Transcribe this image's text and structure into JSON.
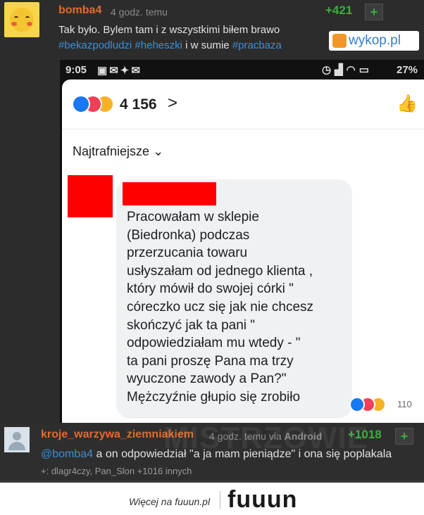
{
  "post": {
    "username": "bomba4",
    "time": "4 godz. temu",
    "score": "+421",
    "plus": "+",
    "line1": "Tak było. Bylem tam i z wszystkimi biłem brawo",
    "tags": [
      "#bekazpodludzi",
      "#heheszki",
      "#pracbaza"
    ],
    "connector": "i w sumie",
    "wykop_logo": "wykop.pl"
  },
  "screenshot": {
    "status_time": "9:05",
    "status_left_icons": [
      "image-icon",
      "mail-icon",
      "twitter-icon",
      "mail-icon"
    ],
    "battery": "27%",
    "reaction_count": "4 156",
    "sort_label": "Najtrafniejsze",
    "comment_lines": [
      "Pracowałam w sklepie",
      "(Biedronka) podczas",
      "przerzucania towaru",
      "usłyszałam od jednego klienta ,",
      "który mówił do swojej córki \"",
      "córeczko ucz się jak nie chcesz",
      "skończyć jak ta pani \"",
      "odpowiedziałam mu wtedy - \"",
      "ta pani proszę Pana ma trzy",
      "wyuczone zawody a Pan?\"",
      "Mężczyźnie głupio się zrobiło"
    ],
    "comment_reaction_count": "110"
  },
  "reply": {
    "username": "kroje_warzywa_ziemniakiem",
    "time": "4 godz. temu",
    "via": "via",
    "platform": "Android",
    "score": "+1018",
    "plus": "+",
    "mention": "@bomba4",
    "text": "a on odpowiedział \"a ja mam pieniądze\" i ona się poplakala",
    "voters": "+: dlagr4czy, Pan_Slon +1016 innych"
  },
  "watermark": "MISTRZOWIE",
  "footer": {
    "text": "Więcej na fuuun.pl",
    "logo": "fuuun"
  },
  "colors": {
    "username": "#e36a2c",
    "tag": "#3b8fd8",
    "score": "#3cae3c",
    "facebook_blue": "#1877f2",
    "footer_logo_accent": "#f3b700"
  }
}
